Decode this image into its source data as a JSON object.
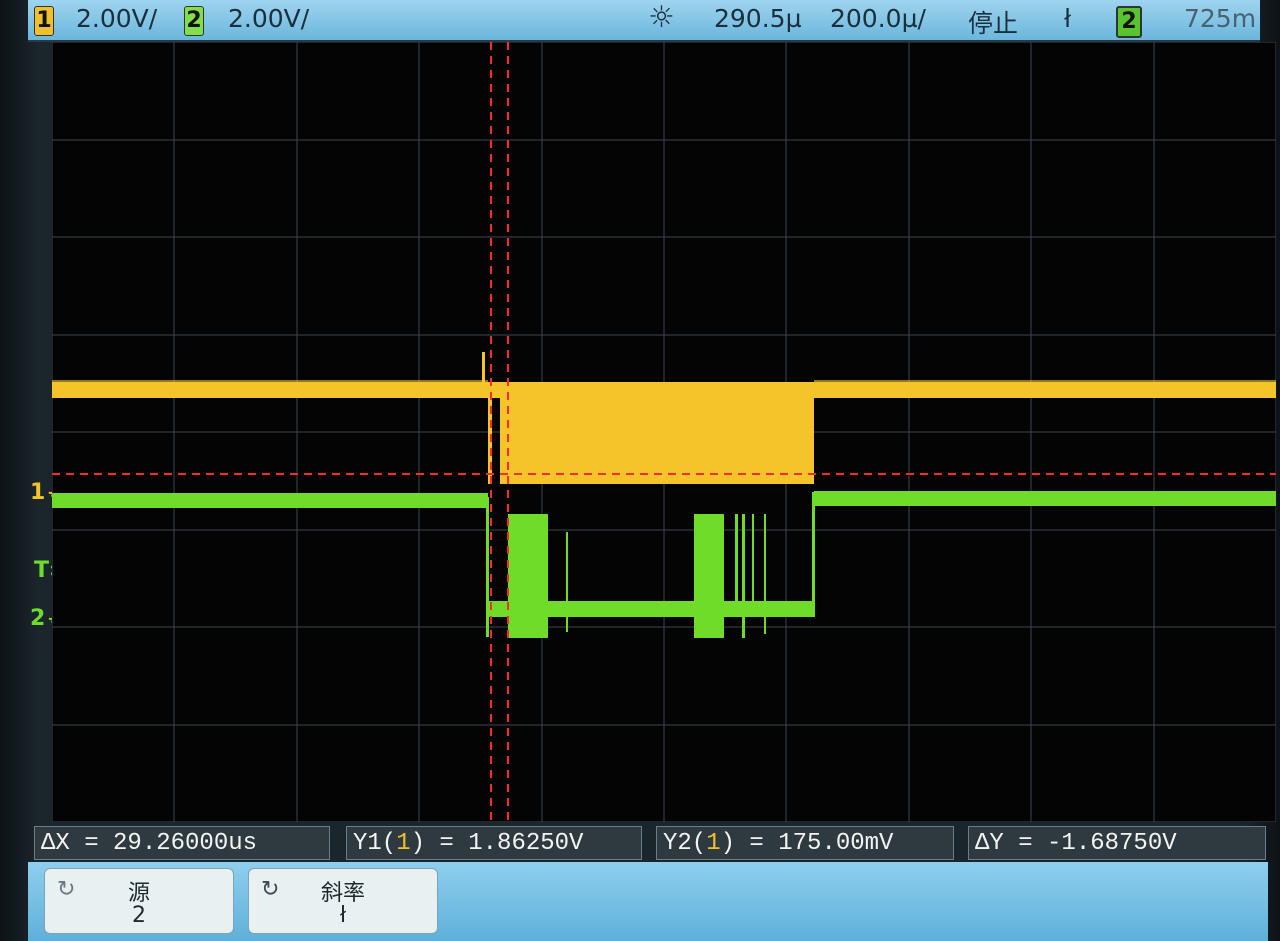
{
  "topbar": {
    "ch1_label": "1",
    "ch1_scale": "2.00V/",
    "ch2_label": "2",
    "ch2_scale": "2.00V/",
    "trigger_icon": "☼",
    "time_delay": "290.5µ",
    "time_scale": "200.0µ/",
    "run_state": "停止",
    "trigger_edge_icon": "ł",
    "trigger_source": "2",
    "trigger_level": "725m"
  },
  "markers": {
    "ch1": "1",
    "trigger": "T",
    "ch2": "2"
  },
  "measurements": {
    "delta_x": "ΔX = 29.26000us",
    "y1_prefix": "Y1(",
    "y1_ch": "1",
    "y1_suffix": ") = 1.86250V",
    "y2_prefix": "Y2(",
    "y2_ch": "1",
    "y2_suffix": ") = 175.00mV",
    "delta_y": "ΔY = -1.68750V"
  },
  "softkeys": [
    {
      "label": "源",
      "value": "2",
      "icon": "rotate-knob-icon"
    },
    {
      "label": "斜率",
      "value": "ł",
      "icon": "rotate-knob-icon"
    }
  ],
  "colors": {
    "ch1": "#f5c428",
    "ch2": "#6fdc2a",
    "cursor": "#ff2a2a",
    "grid": "#3a4650"
  }
}
